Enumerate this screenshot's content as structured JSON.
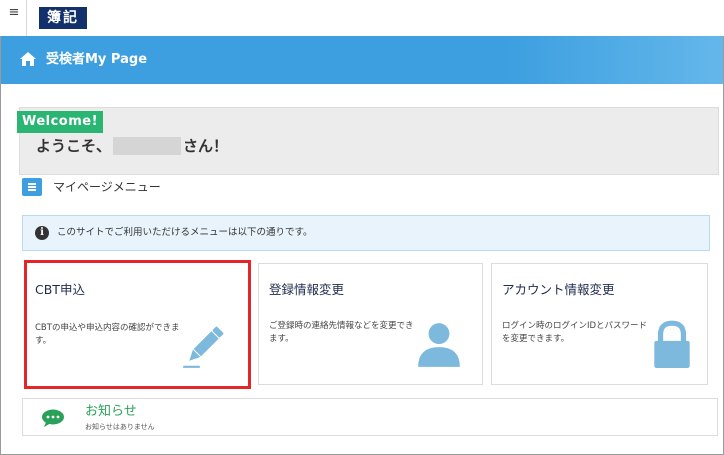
{
  "header": {
    "logo_text": "簿記",
    "menu_icon": "hamburger-icon"
  },
  "banner": {
    "title": "受検者My Page",
    "icon": "home-icon"
  },
  "welcome": {
    "badge": "Welcome!",
    "greeting_prefix": "ようこそ、",
    "greeting_suffix": "さん！"
  },
  "menu_section": {
    "title": "マイページメニュー",
    "icon": "list-icon"
  },
  "info": {
    "text": "このサイトでご利用いただけるメニューは以下の通りです。",
    "icon": "info-icon"
  },
  "cards": [
    {
      "title": "CBT申込",
      "description": "CBTの申込や申込内容の確認ができます。",
      "icon": "pencil-icon",
      "highlighted": true
    },
    {
      "title": "登録情報変更",
      "description": "ご登録時の連絡先情報などを変更できます。",
      "icon": "user-icon",
      "highlighted": false
    },
    {
      "title": "アカウント情報変更",
      "description": "ログイン時のログインIDとパスワードを変更できます。",
      "icon": "lock-icon",
      "highlighted": false
    }
  ],
  "notice": {
    "title": "お知らせ",
    "subtitle": "お知らせはありません",
    "icon": "chat-icon"
  },
  "colors": {
    "banner": "#3d9fe0",
    "welcome_badge": "#2bb573",
    "highlight_border": "#e52629",
    "card_icon": "#7db8dd",
    "logo_bg": "#12306b"
  }
}
